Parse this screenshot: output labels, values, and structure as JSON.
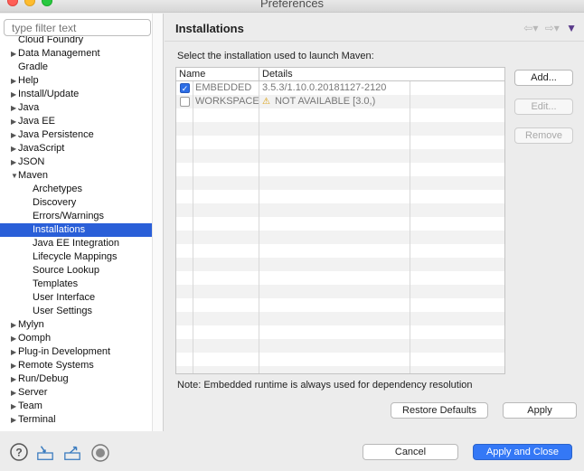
{
  "window": {
    "title": "Preferences"
  },
  "filter": {
    "placeholder": "type filter text"
  },
  "tree": [
    {
      "label": "Cloud Foundry",
      "arrow": "",
      "child": false
    },
    {
      "label": "Data Management",
      "arrow": "▶",
      "child": false
    },
    {
      "label": "Gradle",
      "arrow": "",
      "child": false
    },
    {
      "label": "Help",
      "arrow": "▶",
      "child": false
    },
    {
      "label": "Install/Update",
      "arrow": "▶",
      "child": false
    },
    {
      "label": "Java",
      "arrow": "▶",
      "child": false
    },
    {
      "label": "Java EE",
      "arrow": "▶",
      "child": false
    },
    {
      "label": "Java Persistence",
      "arrow": "▶",
      "child": false
    },
    {
      "label": "JavaScript",
      "arrow": "▶",
      "child": false
    },
    {
      "label": "JSON",
      "arrow": "▶",
      "child": false
    },
    {
      "label": "Maven",
      "arrow": "▼",
      "child": false
    },
    {
      "label": "Archetypes",
      "arrow": "",
      "child": true
    },
    {
      "label": "Discovery",
      "arrow": "",
      "child": true
    },
    {
      "label": "Errors/Warnings",
      "arrow": "",
      "child": true
    },
    {
      "label": "Installations",
      "arrow": "",
      "child": true,
      "selected": true
    },
    {
      "label": "Java EE Integration",
      "arrow": "",
      "child": true
    },
    {
      "label": "Lifecycle Mappings",
      "arrow": "",
      "child": true
    },
    {
      "label": "Source Lookup",
      "arrow": "",
      "child": true
    },
    {
      "label": "Templates",
      "arrow": "",
      "child": true
    },
    {
      "label": "User Interface",
      "arrow": "",
      "child": true
    },
    {
      "label": "User Settings",
      "arrow": "",
      "child": true
    },
    {
      "label": "Mylyn",
      "arrow": "▶",
      "child": false
    },
    {
      "label": "Oomph",
      "arrow": "▶",
      "child": false
    },
    {
      "label": "Plug-in Development",
      "arrow": "▶",
      "child": false
    },
    {
      "label": "Remote Systems",
      "arrow": "▶",
      "child": false
    },
    {
      "label": "Run/Debug",
      "arrow": "▶",
      "child": false
    },
    {
      "label": "Server",
      "arrow": "▶",
      "child": false
    },
    {
      "label": "Team",
      "arrow": "▶",
      "child": false
    },
    {
      "label": "Terminal",
      "arrow": "▶",
      "child": false
    }
  ],
  "page": {
    "title": "Installations",
    "intro": "Select the installation used to launch Maven:",
    "note": "Note: Embedded runtime is always used for dependency resolution"
  },
  "table": {
    "headers": {
      "name": "Name",
      "details": "Details"
    },
    "rows": [
      {
        "checked": true,
        "name": "EMBEDDED",
        "details": "3.5.3/1.10.0.20181127-2120",
        "warning": false
      },
      {
        "checked": false,
        "name": "WORKSPACE",
        "details": "NOT AVAILABLE [3.0,)",
        "warning": true
      }
    ]
  },
  "buttons": {
    "add": "Add...",
    "edit": "Edit...",
    "remove": "Remove",
    "restore_defaults": "Restore Defaults",
    "apply": "Apply",
    "cancel": "Cancel",
    "apply_close": "Apply and Close"
  },
  "icons": {
    "help": "help-icon",
    "import": "import-icon",
    "export": "export-icon",
    "record": "record-icon"
  },
  "colors": {
    "selection": "#2a5fd8",
    "primary_button": "#3478f6",
    "warning": "#d99a00"
  }
}
